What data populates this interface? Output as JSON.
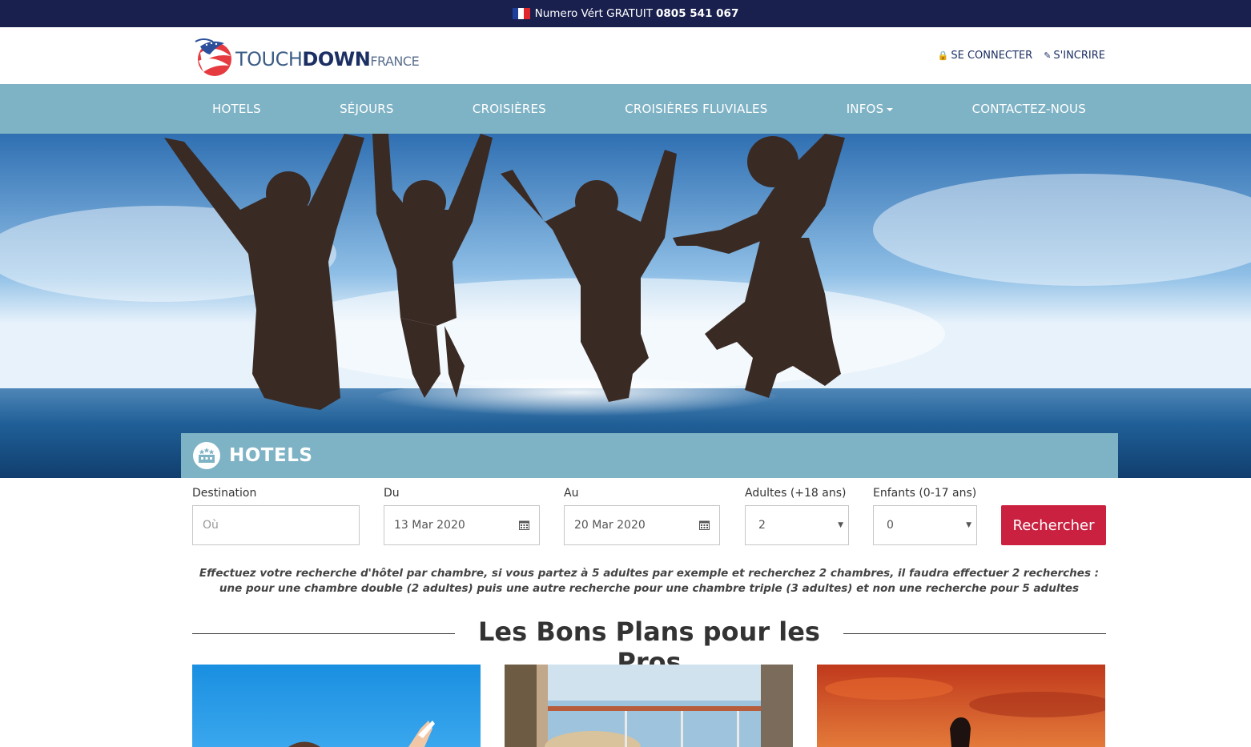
{
  "topbar": {
    "label": "Numero Vért GRATUIT",
    "phone": "0805 541 067"
  },
  "header": {
    "logo": {
      "part1": "TOUCH",
      "part2": "DOWN",
      "part3": "FRANCE"
    },
    "auth": {
      "login": "SE CONNECTER",
      "signup": "S'INCRIRE"
    }
  },
  "nav": {
    "items": [
      "HOTELS",
      "SÉJOURS",
      "CROISIÈRES",
      "CROISIÈRES FLUVIALES",
      "INFOS",
      "CONTACTEZ-NOUS"
    ]
  },
  "panel": {
    "title": "HOTELS"
  },
  "search": {
    "destination_label": "Destination",
    "destination_placeholder": "Où",
    "from_label": "Du",
    "from_value": "13 Mar 2020",
    "to_label": "Au",
    "to_value": "20 Mar 2020",
    "adults_label": "Adultes (+18 ans)",
    "adults_value": "2",
    "children_label": "Enfants (0-17 ans)",
    "children_value": "0",
    "submit": "Rechercher"
  },
  "note": "Effectuez votre recherche d'hôtel par chambre, si vous partez à 5 adultes par exemple et recherchez 2 chambres, il faudra effectuer 2 recherches : une pour une chambre double (2 adultes) puis une autre recherche pour une chambre triple (3 adultes) et non une recherche pour 5 adultes",
  "section": {
    "title": "Les Bons Plans pour les Pros"
  },
  "colors": {
    "topbar": "#19204e",
    "nav": "#7eb2c5",
    "button": "#c9213f",
    "brand_dark": "#1c2f63"
  }
}
